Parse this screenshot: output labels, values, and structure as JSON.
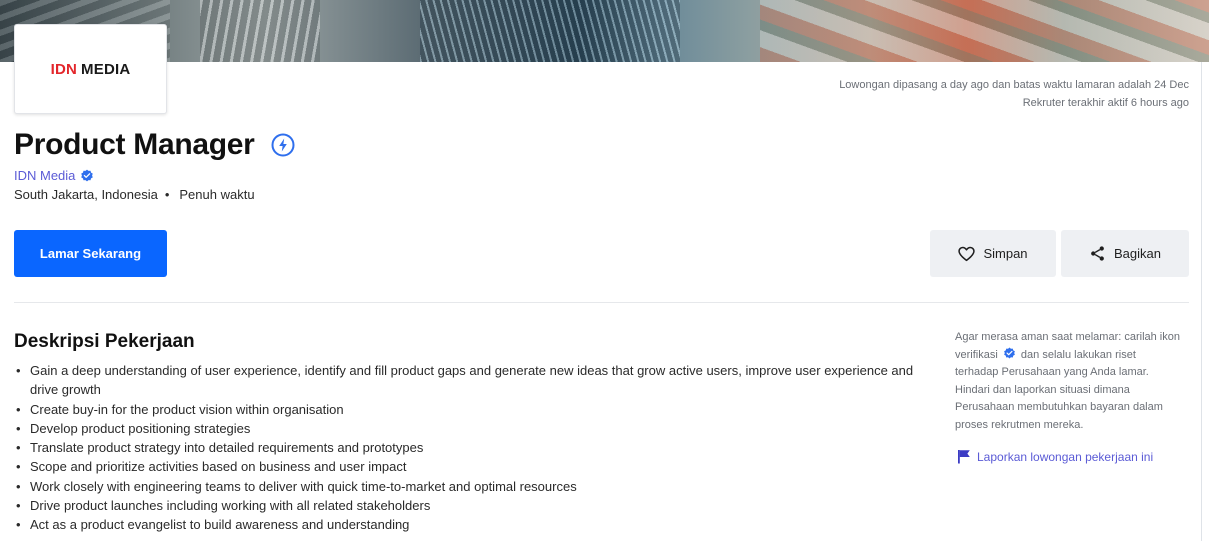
{
  "company": {
    "logo_part1": "IDN",
    "logo_part2": "MEDIA",
    "name": "IDN Media"
  },
  "meta": {
    "posted": "Lowongan dipasang a day ago dan batas waktu lamaran adalah 24 Dec",
    "recruiter_active": "Rekruter terakhir aktif 6 hours ago"
  },
  "job": {
    "title": "Product Manager",
    "location": "South Jakarta, Indonesia",
    "type": "Penuh waktu"
  },
  "actions": {
    "apply_label": "Lamar Sekarang",
    "save_label": "Simpan",
    "share_label": "Bagikan"
  },
  "description": {
    "heading": "Deskripsi Pekerjaan",
    "items": [
      "Gain a deep understanding of user experience, identify and fill product gaps and generate new ideas that grow active users, improve user experience and drive growth",
      "Create buy-in for the product vision within organisation",
      "Develop product positioning strategies",
      "Translate product strategy into detailed requirements and prototypes",
      "Scope and prioritize activities based on business and user impact",
      "Work closely with engineering teams to deliver with quick time-to-market and optimal resources",
      "Drive product launches including working with all related stakeholders",
      "Act as a product evangelist to build awareness and understanding"
    ]
  },
  "safety": {
    "text_before_icon": "Agar merasa aman saat melamar: carilah ikon verifikasi",
    "text_after_icon": "dan selalu lakukan riset terhadap Perusahaan yang Anda lamar. Hindari dan laporkan situasi dimana Perusahaan membutuhkan bayaran dalam proses rekrutmen mereka.",
    "report_label": "Laporkan lowongan pekerjaan ini"
  },
  "colors": {
    "primary": "#0a66ff",
    "link": "#5b5bd6",
    "verified": "#2f6fed",
    "logo_red": "#e3262b"
  },
  "icons": [
    "lightning-bolt-icon",
    "verified-badge-icon",
    "heart-icon",
    "share-icon",
    "flag-icon"
  ]
}
